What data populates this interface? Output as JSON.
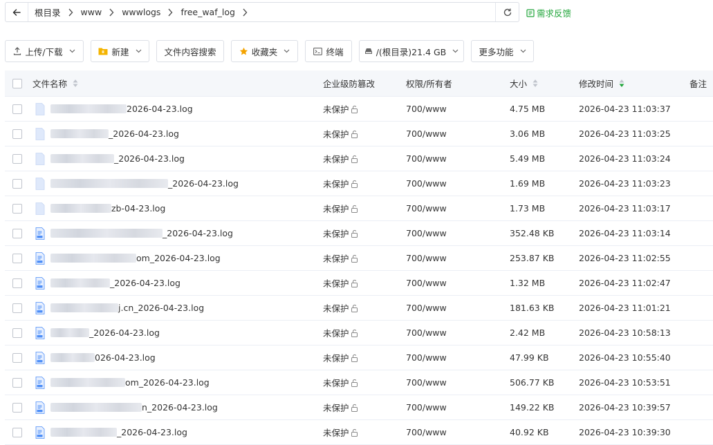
{
  "breadcrumb": {
    "items": [
      "根目录",
      "www",
      "wwwlogs",
      "free_waf_log"
    ]
  },
  "feedback_label": "需求反馈",
  "toolbar": {
    "upload_label": "上传/下载",
    "new_label": "新建",
    "search_content_label": "文件内容搜索",
    "favorites_label": "收藏夹",
    "terminal_label": "终端",
    "disk_label": "/(根目录)21.4 GB",
    "more_label": "更多功能"
  },
  "columns": {
    "name": "文件名称",
    "protect": "企业级防篡改",
    "perm": "权限/所有者",
    "size": "大小",
    "mtime": "修改时间",
    "note": "备注"
  },
  "colors": {
    "accent_green": "#20a53a",
    "icon_blue": "#4d8ef8"
  },
  "rows": [
    {
      "name_visible": "2026-04-23.log",
      "protect": "未保护",
      "perm": "700/www",
      "size": "4.75 MB",
      "mtime": "2026-04-23 11:03:37"
    },
    {
      "name_visible": "_2026-04-23.log",
      "protect": "未保护",
      "perm": "700/www",
      "size": "3.06 MB",
      "mtime": "2026-04-23 11:03:25"
    },
    {
      "name_visible": "_2026-04-23.log",
      "protect": "未保护",
      "perm": "700/www",
      "size": "5.49 MB",
      "mtime": "2026-04-23 11:03:24"
    },
    {
      "name_visible": "_2026-04-23.log",
      "protect": "未保护",
      "perm": "700/www",
      "size": "1.69 MB",
      "mtime": "2026-04-23 11:03:23"
    },
    {
      "name_visible": "zb-04-23.log",
      "protect": "未保护",
      "perm": "700/www",
      "size": "1.73 MB",
      "mtime": "2026-04-23 11:03:17"
    },
    {
      "name_visible": "_2026-04-23.log",
      "protect": "未保护",
      "perm": "700/www",
      "size": "352.48 KB",
      "mtime": "2026-04-23 11:03:14"
    },
    {
      "name_visible": "om_2026-04-23.log",
      "protect": "未保护",
      "perm": "700/www",
      "size": "253.87 KB",
      "mtime": "2026-04-23 11:02:55"
    },
    {
      "name_visible": "_2026-04-23.log",
      "protect": "未保护",
      "perm": "700/www",
      "size": "1.32 MB",
      "mtime": "2026-04-23 11:02:47"
    },
    {
      "name_visible": "j.cn_2026-04-23.log",
      "protect": "未保护",
      "perm": "700/www",
      "size": "181.63 KB",
      "mtime": "2026-04-23 11:01:21"
    },
    {
      "name_visible": "_2026-04-23.log",
      "protect": "未保护",
      "perm": "700/www",
      "size": "2.42 MB",
      "mtime": "2026-04-23 10:58:13"
    },
    {
      "name_visible": "026-04-23.log",
      "protect": "未保护",
      "perm": "700/www",
      "size": "47.99 KB",
      "mtime": "2026-04-23 10:55:40"
    },
    {
      "name_visible": "om_2026-04-23.log",
      "protect": "未保护",
      "perm": "700/www",
      "size": "506.77 KB",
      "mtime": "2026-04-23 10:53:51"
    },
    {
      "name_visible": "n_2026-04-23.log",
      "protect": "未保护",
      "perm": "700/www",
      "size": "149.22 KB",
      "mtime": "2026-04-23 10:39:57"
    },
    {
      "name_visible": "_2026-04-23.log",
      "protect": "未保护",
      "perm": "700/www",
      "size": "40.92 KB",
      "mtime": "2026-04-23 10:39:30"
    }
  ]
}
